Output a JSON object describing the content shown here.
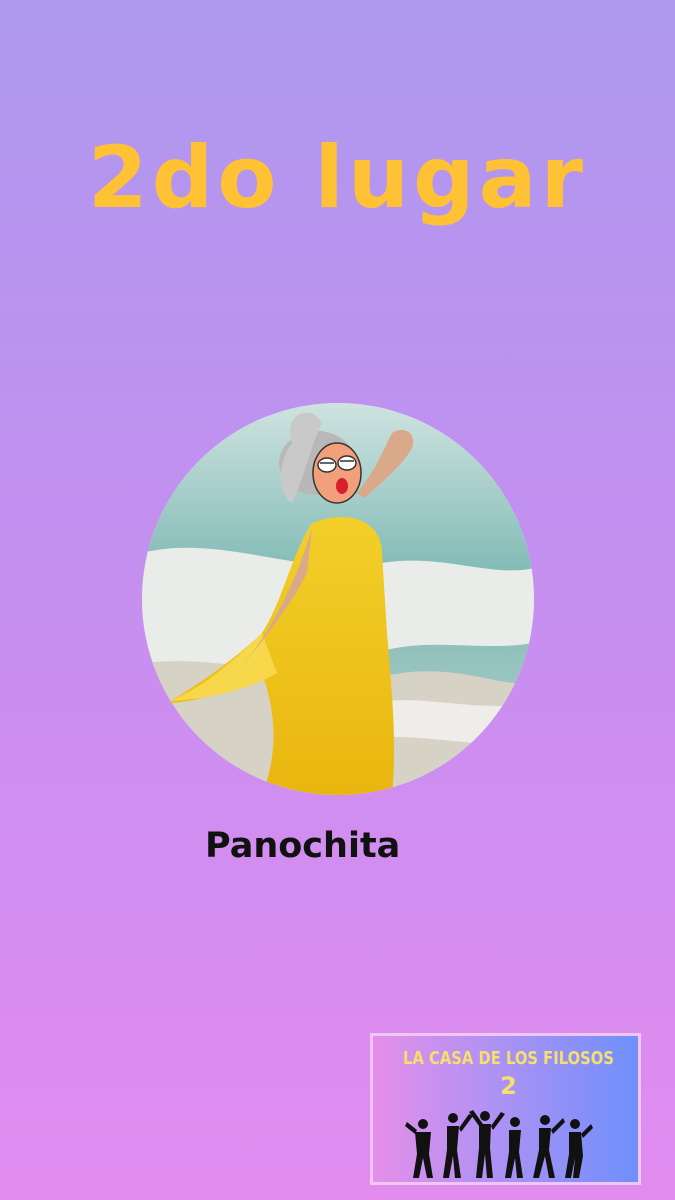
{
  "title": "2do lugar",
  "winner": {
    "name": "Panochita"
  },
  "logo": {
    "line1": "LA CASA DE LOS FILOSOS",
    "line2": "2"
  },
  "colors": {
    "background_top": "#ad98ee",
    "background_bottom": "#e28bef",
    "title": "#ffc234",
    "logo_text": "#f5e06d"
  }
}
